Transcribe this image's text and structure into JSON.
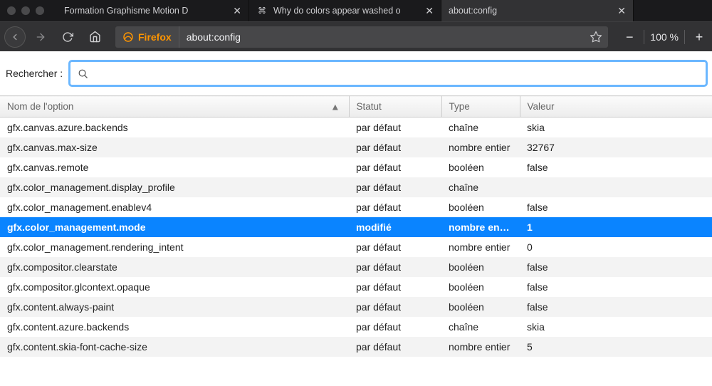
{
  "tabs": [
    {
      "title": "Formation Graphisme Motion D",
      "favicon": ""
    },
    {
      "title": "Why do colors appear washed o",
      "favicon": "⌘"
    },
    {
      "title": "about:config",
      "favicon": "",
      "active": true
    }
  ],
  "urlbar": {
    "identity": "Firefox",
    "url": "about:config"
  },
  "zoom": {
    "level": "100 %"
  },
  "search": {
    "label": "Rechercher :",
    "value": ""
  },
  "columns": {
    "name": "Nom de l'option",
    "status": "Statut",
    "type": "Type",
    "value": "Valeur",
    "sort_indicator": "▲"
  },
  "rows": [
    {
      "name": "gfx.canvas.azure.backends",
      "status": "par défaut",
      "type": "chaîne",
      "value": "skia"
    },
    {
      "name": "gfx.canvas.max-size",
      "status": "par défaut",
      "type": "nombre entier",
      "value": "32767"
    },
    {
      "name": "gfx.canvas.remote",
      "status": "par défaut",
      "type": "booléen",
      "value": "false"
    },
    {
      "name": "gfx.color_management.display_profile",
      "status": "par défaut",
      "type": "chaîne",
      "value": ""
    },
    {
      "name": "gfx.color_management.enablev4",
      "status": "par défaut",
      "type": "booléen",
      "value": "false"
    },
    {
      "name": "gfx.color_management.mode",
      "status": "modifié",
      "type": "nombre entier",
      "value": "1",
      "selected": true
    },
    {
      "name": "gfx.color_management.rendering_intent",
      "status": "par défaut",
      "type": "nombre entier",
      "value": "0"
    },
    {
      "name": "gfx.compositor.clearstate",
      "status": "par défaut",
      "type": "booléen",
      "value": "false"
    },
    {
      "name": "gfx.compositor.glcontext.opaque",
      "status": "par défaut",
      "type": "booléen",
      "value": "false"
    },
    {
      "name": "gfx.content.always-paint",
      "status": "par défaut",
      "type": "booléen",
      "value": "false"
    },
    {
      "name": "gfx.content.azure.backends",
      "status": "par défaut",
      "type": "chaîne",
      "value": "skia"
    },
    {
      "name": "gfx.content.skia-font-cache-size",
      "status": "par défaut",
      "type": "nombre entier",
      "value": "5"
    }
  ]
}
